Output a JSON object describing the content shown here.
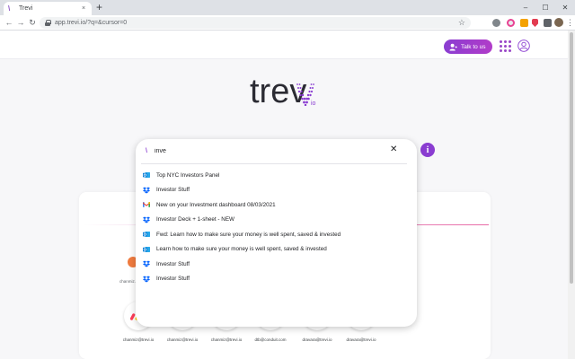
{
  "browser": {
    "tab_title": "Trevi",
    "new_tab": "+",
    "tab_close": "×",
    "url": "app.trevi.io/?q=&cursor=0",
    "star": "☆",
    "menu": "⋮",
    "back": "←",
    "forward": "→",
    "reload": "↻",
    "minimize": "–",
    "maximize": "☐",
    "close": "✕"
  },
  "header": {
    "talk_button": "Talk to us"
  },
  "logo": {
    "text": "trev",
    "suffix": "io",
    "accent": "#8a3dd1"
  },
  "info_button": "i",
  "search": {
    "value": "inve",
    "clear": "✕",
    "results": [
      {
        "icon": "outlook-icon",
        "label": "Top NYC Investors Panel"
      },
      {
        "icon": "dropbox-icon",
        "label": "Investor Stuff"
      },
      {
        "icon": "gmail-icon",
        "label": "New on your Investment dashboard 08/03/2021"
      },
      {
        "icon": "dropbox-icon",
        "label": "Investor Deck + 1-sheet - NEW"
      },
      {
        "icon": "outlook-icon",
        "label": "Fwd: Learn how to make sure your money is well spent, saved & invested"
      },
      {
        "icon": "outlook-icon",
        "label": "Learn how to make sure your money is well spent, saved & invested"
      },
      {
        "icon": "dropbox-icon",
        "label": "Investor Stuff"
      },
      {
        "icon": "dropbox-icon",
        "label": "Investor Stuff"
      }
    ]
  },
  "card": {
    "partial_label": "chanmiz..."
  },
  "apps": [
    {
      "icon": "monday-icon",
      "label": "chanmiz@trevi.io"
    },
    {
      "icon": "onedrive-icon",
      "label": "chanmiz@trevi.io"
    },
    {
      "icon": "outlook-icon",
      "label": "chanmiz@trevi.io"
    },
    {
      "icon": "outlook-icon",
      "label": "dtb@conduit.com"
    },
    {
      "icon": "slack-icon",
      "label": "dravara@trevi.io"
    },
    {
      "icon": "teams-icon",
      "label": "dravara@trevi.io"
    }
  ],
  "colors": {
    "brand_purple": "#8a3dd1",
    "dropbox_blue": "#0061fe",
    "outlook_blue": "#0078d4",
    "gmail_red": "#ea4335"
  }
}
